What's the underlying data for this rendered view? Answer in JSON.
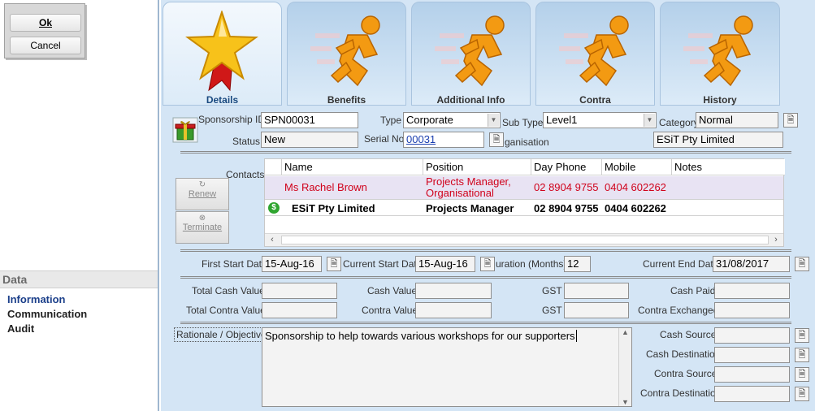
{
  "buttons": {
    "ok": "Ok",
    "cancel": "Cancel"
  },
  "nav": {
    "header": "Data",
    "items": [
      "Information",
      "Communication",
      "Audit"
    ],
    "active_color": "#1b3f8a"
  },
  "tabs": [
    {
      "label": "Details",
      "icon": "star-ribbon-icon",
      "active": true
    },
    {
      "label": "Benefits",
      "icon": "running-man-icon"
    },
    {
      "label": "Additional Info",
      "icon": "running-man-icon"
    },
    {
      "label": "Contra",
      "icon": "running-man-icon"
    },
    {
      "label": "History",
      "icon": "running-man-icon"
    }
  ],
  "details": {
    "sponsorship_id_label": "Sponsorship ID",
    "sponsorship_id": "SPN00031",
    "type_label": "Type",
    "type": "Corporate",
    "sub_type_label": "Sub Type",
    "sub_type": "Level1",
    "category_label": "Category",
    "category": "Normal",
    "status_label": "Status",
    "status": "New",
    "serial_no_label": "Serial No",
    "serial_no": "00031",
    "organisation_label": "ganisation",
    "organisation": "ESiT Pty Limited"
  },
  "contacts": {
    "label": "Contacts",
    "renew": "Renew",
    "terminate": "Terminate",
    "columns": [
      "Name",
      "Position",
      "Day Phone",
      "Mobile",
      "Notes"
    ],
    "rows": [
      {
        "name": "Ms Rachel Brown",
        "position": "Projects Manager, Organisational",
        "day_phone": "02 8904 9755",
        "mobile": "0404 602262",
        "notes": "",
        "color": "#d0021b"
      },
      {
        "name": "ESiT Pty Limited",
        "position": "Projects Manager",
        "day_phone": "02 8904 9755",
        "mobile": "0404 602262",
        "notes": "",
        "color": "#000000"
      }
    ]
  },
  "dates": {
    "first_start_label": "First Start Date",
    "first_start": "15-Aug-16",
    "current_start_label": "Current Start Date",
    "current_start": "15-Aug-16",
    "duration_label": "uration (Months)",
    "duration": "12",
    "current_end_label": "Current End Date",
    "current_end": "31/08/2017"
  },
  "values": {
    "total_cash_value": "Total Cash Value",
    "cash_value": "Cash Value",
    "gst": "GST",
    "cash_paid": "Cash Paid",
    "total_contra_value": "Total Contra Value",
    "contra_value": "Contra Value",
    "contra_exchanged": "Contra Exchanged"
  },
  "rationale": {
    "label": "Rationale / Objectives",
    "text": "Sponsorship to help towards various workshops for our supporters",
    "cash_source": "Cash Source",
    "cash_destination": "Cash Destination",
    "contra_source": "Contra Source",
    "contra_destination": "Contra Destination"
  }
}
